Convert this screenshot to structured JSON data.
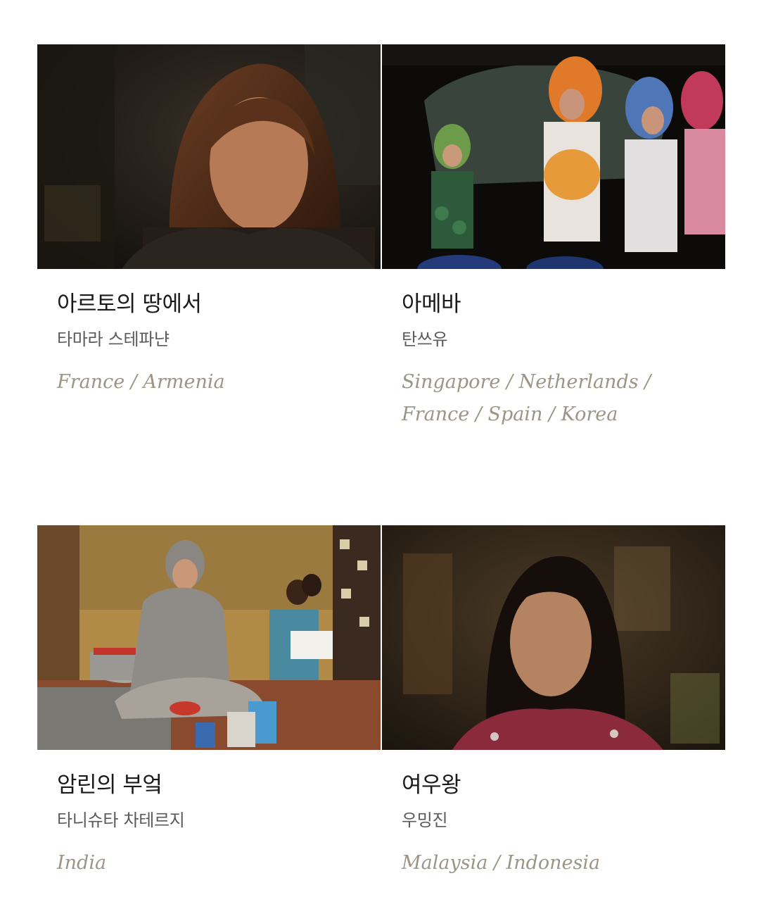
{
  "films": [
    {
      "title": "아르토의 땅에서",
      "director": "타마라 스테파냔",
      "country": "France / Armenia",
      "still_icon": "film-still-woman-portrait"
    },
    {
      "title": "아메바",
      "director": "탄쓰유",
      "country": "Singapore / Netherlands / France / Spain / Korea",
      "still_icon": "film-still-costumed-students"
    },
    {
      "title": "암린의 부엌",
      "director": "타니슈타 차테르지",
      "country": "India",
      "still_icon": "film-still-kitchen-scene"
    },
    {
      "title": "여우왕",
      "director": "우밍진",
      "country": "Malaysia / Indonesia",
      "still_icon": "film-still-woman-closeup"
    }
  ]
}
